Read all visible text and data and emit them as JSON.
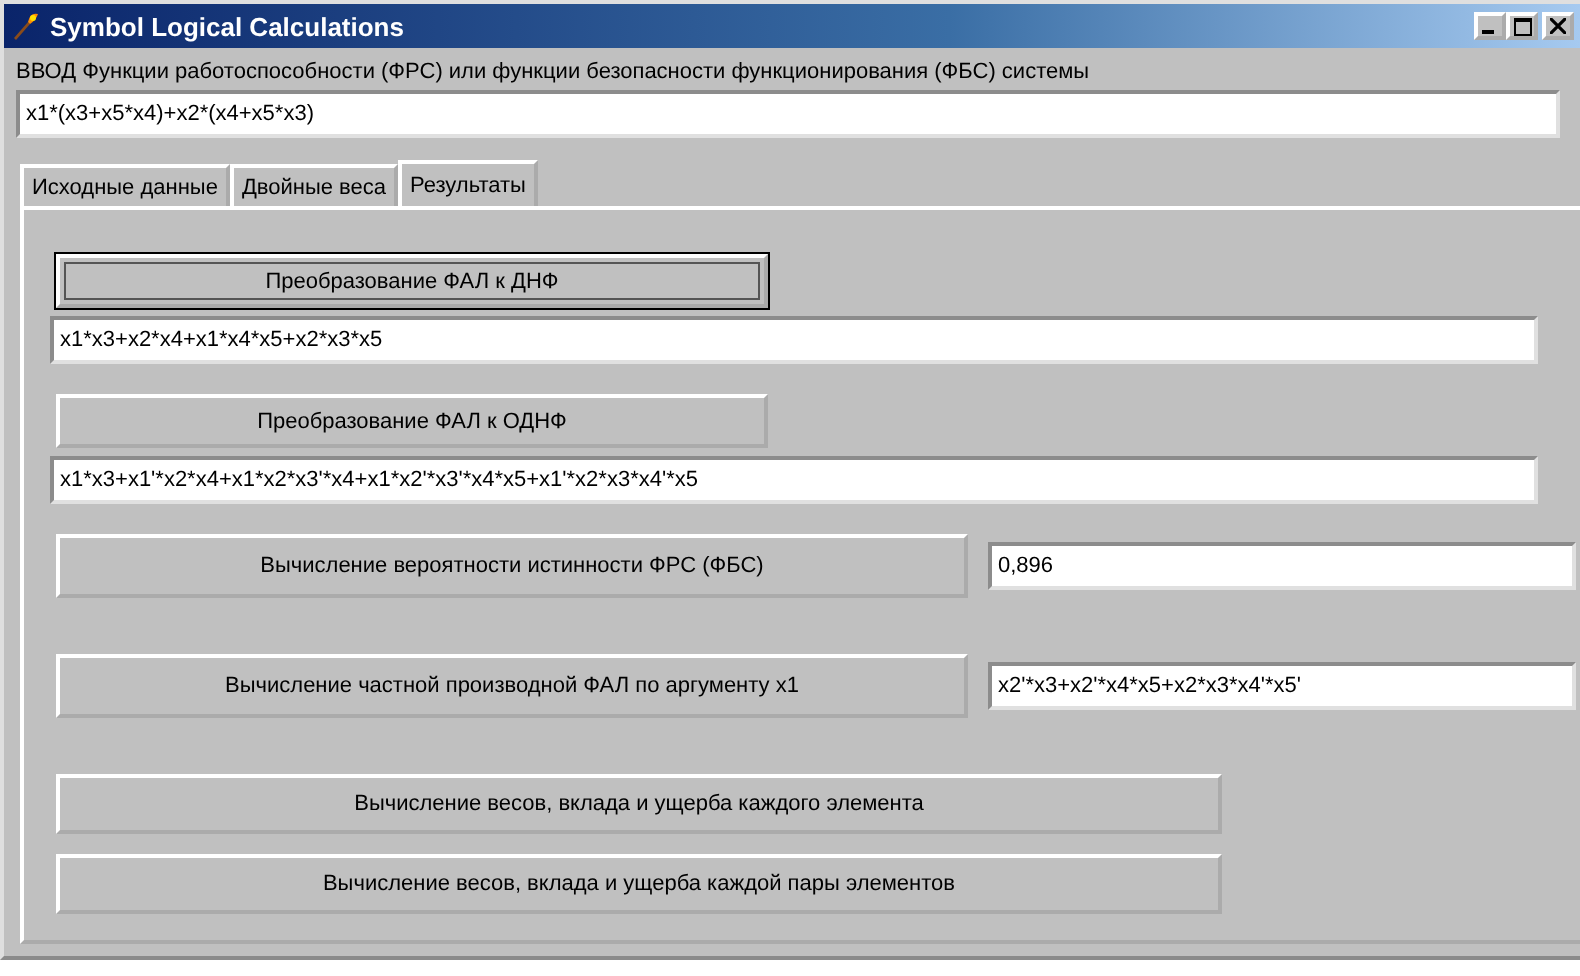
{
  "window": {
    "title": "Symbol Logical Calculations"
  },
  "input": {
    "label": "ВВОД Функции работоспособности (ФРС) или функции безопасности функционирования (ФБС) системы",
    "value": "x1*(x3+x5*x4)+x2*(x4+x5*x3)"
  },
  "tabs": [
    {
      "label": "Исходные данные",
      "selected": false
    },
    {
      "label": "Двойные веса",
      "selected": false
    },
    {
      "label": "Результаты",
      "selected": true
    }
  ],
  "actions": [
    {
      "kind": "below",
      "label": "Преобразование ФАЛ к ДНФ",
      "focused": true,
      "output": "x1*x3+x2*x4+x1*x4*x5+x2*x3*x5"
    },
    {
      "kind": "below",
      "label": "Преобразование ФАЛ к ОДНФ",
      "focused": false,
      "output": "x1*x3+x1'*x2*x4+x1*x2*x3'*x4+x1*x2'*x3'*x4*x5+x1'*x2*x3*x4'*x5"
    },
    {
      "kind": "beside",
      "label": "Вычисление вероятности истинности ФРС (ФБС)",
      "focused": false,
      "output": "0,896"
    },
    {
      "kind": "beside",
      "label": "Вычисление частной производной ФАЛ по аргументу x1",
      "focused": false,
      "output": "x2'*x3+x2'*x4*x5+x2*x3*x4'*x5'"
    },
    {
      "kind": "plain",
      "label": "Вычисление весов, вклада и ущерба каждого элемента",
      "focused": false
    },
    {
      "kind": "plain",
      "label": "Вычисление весов, вклада и ущерба каждой пары элементов",
      "focused": false
    }
  ]
}
